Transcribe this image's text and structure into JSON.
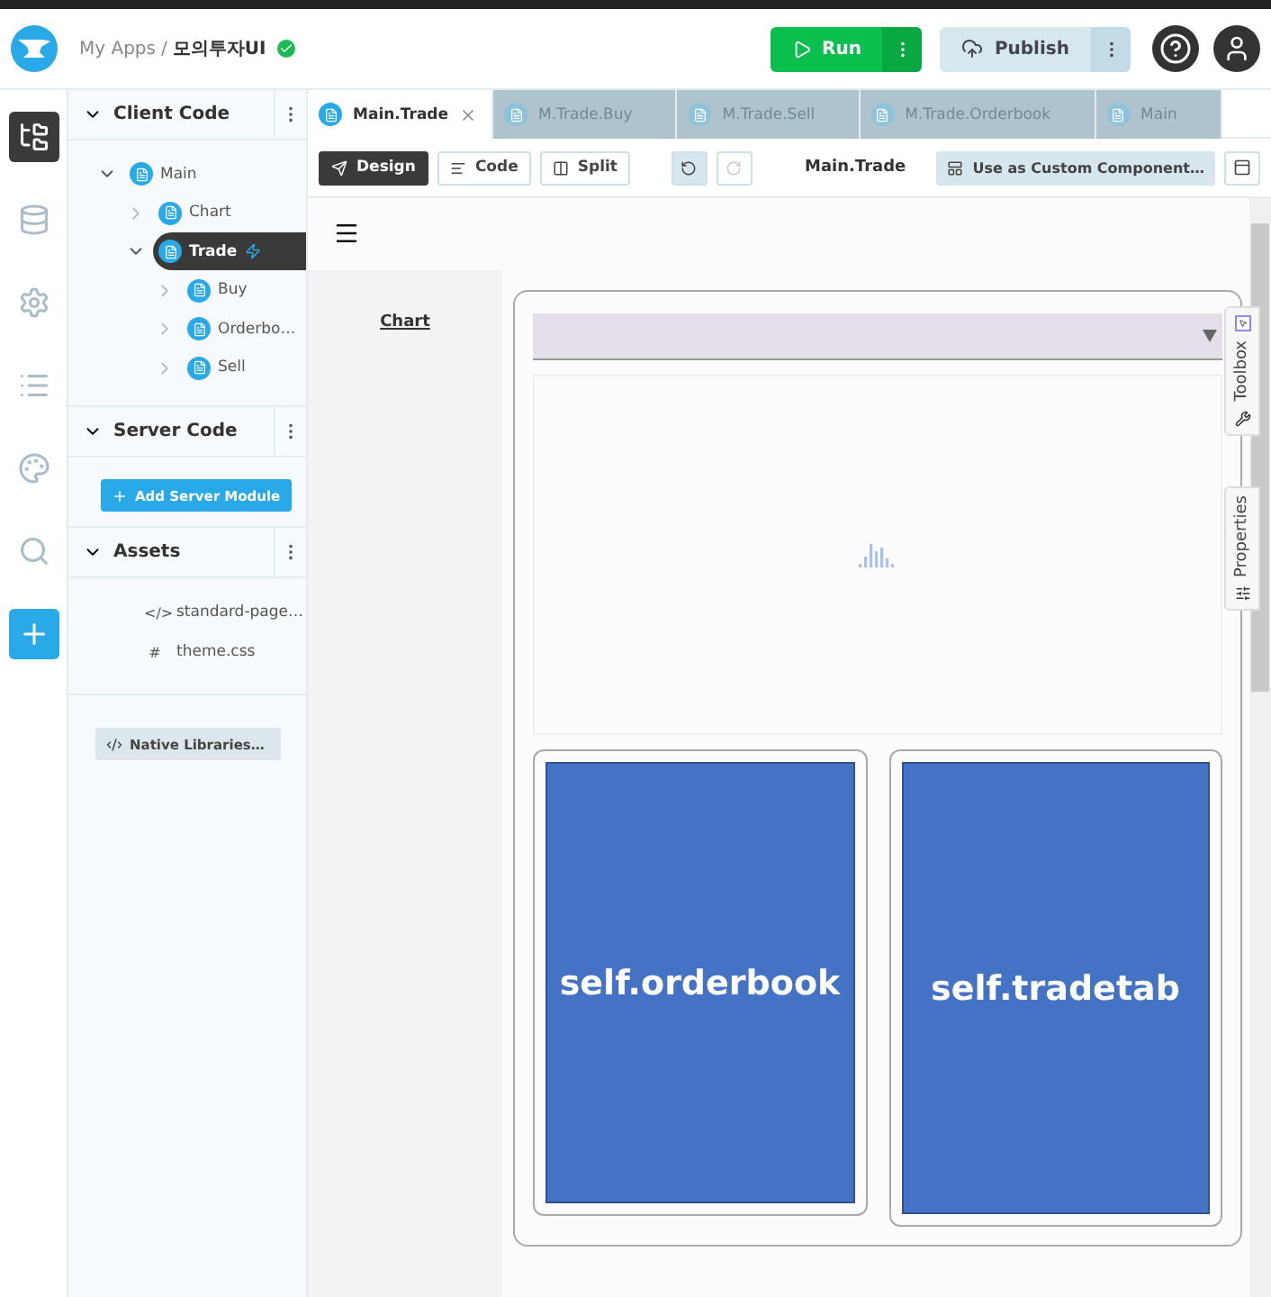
{
  "breadcrumb": {
    "parent": "My Apps",
    "separator": "/",
    "current": "모의투자UI",
    "saved": true
  },
  "header_buttons": [
    {
      "kind": "run",
      "label": "Run"
    },
    {
      "kind": "publish",
      "label": "Publish"
    }
  ],
  "rail": [
    {
      "selected": true
    },
    {
      "selected": false
    },
    {
      "selected": false
    },
    {
      "selected": false
    },
    {
      "selected": false
    },
    {
      "selected": false
    }
  ],
  "client_code": {
    "title": "Client Code",
    "tree": [
      {
        "label": "Main",
        "selected": false,
        "expanded": true,
        "children": [
          {
            "label": "Chart",
            "selected": false,
            "expanded": false
          },
          {
            "label": "Trade",
            "selected": true,
            "expanded": true,
            "children": [
              {
                "label": "Buy",
                "selected": false,
                "expanded": false
              },
              {
                "label": "Orderbo…",
                "selected": false,
                "expanded": false
              },
              {
                "label": "Sell",
                "selected": false,
                "expanded": false
              }
            ]
          }
        ]
      }
    ]
  },
  "server_code": {
    "title": "Server Code",
    "button": "Add Server Module"
  },
  "assets": {
    "title": "Assets",
    "items": [
      {
        "glyph": "</>",
        "label": "standard-page…"
      },
      {
        "glyph": "#",
        "label": "theme.css"
      }
    ]
  },
  "native_libraries": "Native Libraries…",
  "tabs": [
    {
      "label": "Main.Trade",
      "selected": true
    },
    {
      "label": "M.Trade.Buy",
      "selected": false
    },
    {
      "label": "M.Trade.Sell",
      "selected": false
    },
    {
      "label": "M.Trade.Orderbook",
      "selected": false
    },
    {
      "label": "Main",
      "selected": false
    }
  ],
  "view_modes": [
    {
      "label": "Design",
      "selected": true
    },
    {
      "label": "Code",
      "selected": false
    },
    {
      "label": "Split",
      "selected": false
    }
  ],
  "form_name": "Main.Trade",
  "custom_component_button": "Use as Custom Component…",
  "canvas": {
    "nav_link": "Chart",
    "cards": [
      {
        "label": "self.orderbook"
      },
      {
        "label": "self.tradetab"
      }
    ]
  },
  "side_tabs": [
    {
      "label": "Toolbox"
    },
    {
      "label": "Properties"
    }
  ]
}
